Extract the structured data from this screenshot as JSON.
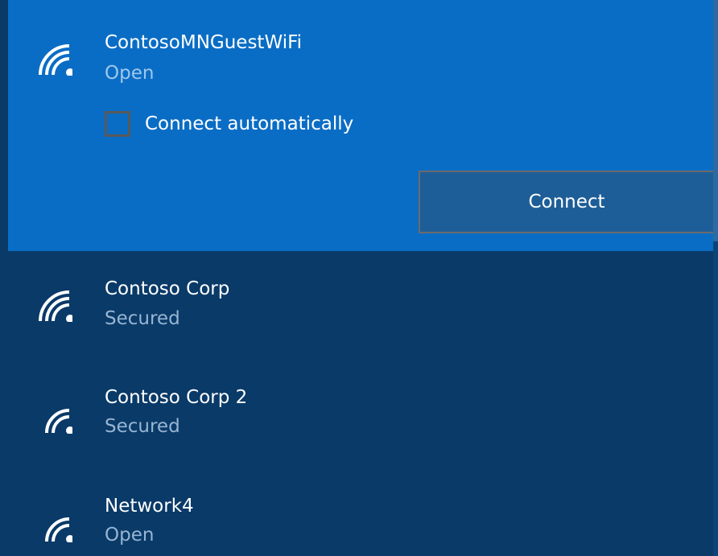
{
  "networks": [
    {
      "name": "ContosoMNGuestWiFi",
      "status": "Open",
      "icon": "wifi-signal-full-icon",
      "expanded": true,
      "connect_automatically_label": "Connect automatically",
      "connect_automatically_checked": false,
      "connect_button_label": "Connect"
    },
    {
      "name": "Contoso Corp",
      "status": "Secured",
      "icon": "wifi-signal-full-icon"
    },
    {
      "name": "Contoso Corp 2",
      "status": "Secured",
      "icon": "wifi-signal-medium-icon"
    },
    {
      "name": "Network4",
      "status": "Open",
      "icon": "wifi-signal-medium-icon"
    }
  ],
  "colors": {
    "panel_background": "#0a3a68",
    "selected_background": "#0a6dc5",
    "button_background": "#1e5e98",
    "status_text": "#97b5d3",
    "primary_text": "#ffffff"
  }
}
